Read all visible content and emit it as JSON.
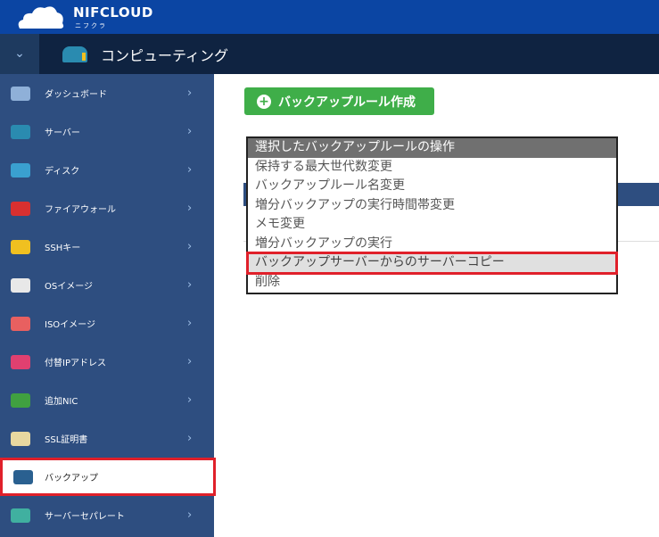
{
  "header": {
    "brand": "NIFCLOUD",
    "brand_sub": "ニフクラ",
    "service": "コンピューティング"
  },
  "sidebar": {
    "items": [
      {
        "label": "ダッシュボード",
        "icon": "dashboard-icon",
        "color": "#8fb0d8"
      },
      {
        "label": "サーバー",
        "icon": "server-icon",
        "color": "#2a8bb0"
      },
      {
        "label": "ディスク",
        "icon": "disk-icon",
        "color": "#3aa0d0"
      },
      {
        "label": "ファイアウォール",
        "icon": "firewall-icon",
        "color": "#d83030"
      },
      {
        "label": "SSHキー",
        "icon": "key-icon",
        "color": "#f0c020"
      },
      {
        "label": "OSイメージ",
        "icon": "os-image-icon",
        "color": "#e8e8e8"
      },
      {
        "label": "ISOイメージ",
        "icon": "iso-image-icon",
        "color": "#e86060"
      },
      {
        "label": "付替IPアドレス",
        "icon": "ip-icon",
        "color": "#e04070"
      },
      {
        "label": "追加NIC",
        "icon": "nic-icon",
        "color": "#40a040"
      },
      {
        "label": "SSL証明書",
        "icon": "certificate-icon",
        "color": "#e8d8a0"
      },
      {
        "label": "バックアップ",
        "icon": "backup-icon",
        "color": "#2a6090",
        "selected": true
      },
      {
        "label": "サーバーセパレート",
        "icon": "separate-icon",
        "color": "#40b0a0"
      }
    ]
  },
  "main": {
    "create_button": "バックアップルール作成",
    "dropdown": {
      "options": [
        "選択したバックアップルールの操作",
        "保持する最大世代数変更",
        "バックアップルール名変更",
        "増分バックアップの実行時間帯変更",
        "メモ変更",
        "増分バックアップの実行",
        "バックアップサーバーからのサーバーコピー",
        "削除"
      ],
      "highlighted": "バックアップサーバーからのサーバーコピー"
    }
  },
  "colors": {
    "header": "#0b45a3",
    "sidebar": "#2e4e80",
    "button": "#3fae49",
    "highlight": "#e0202a"
  }
}
